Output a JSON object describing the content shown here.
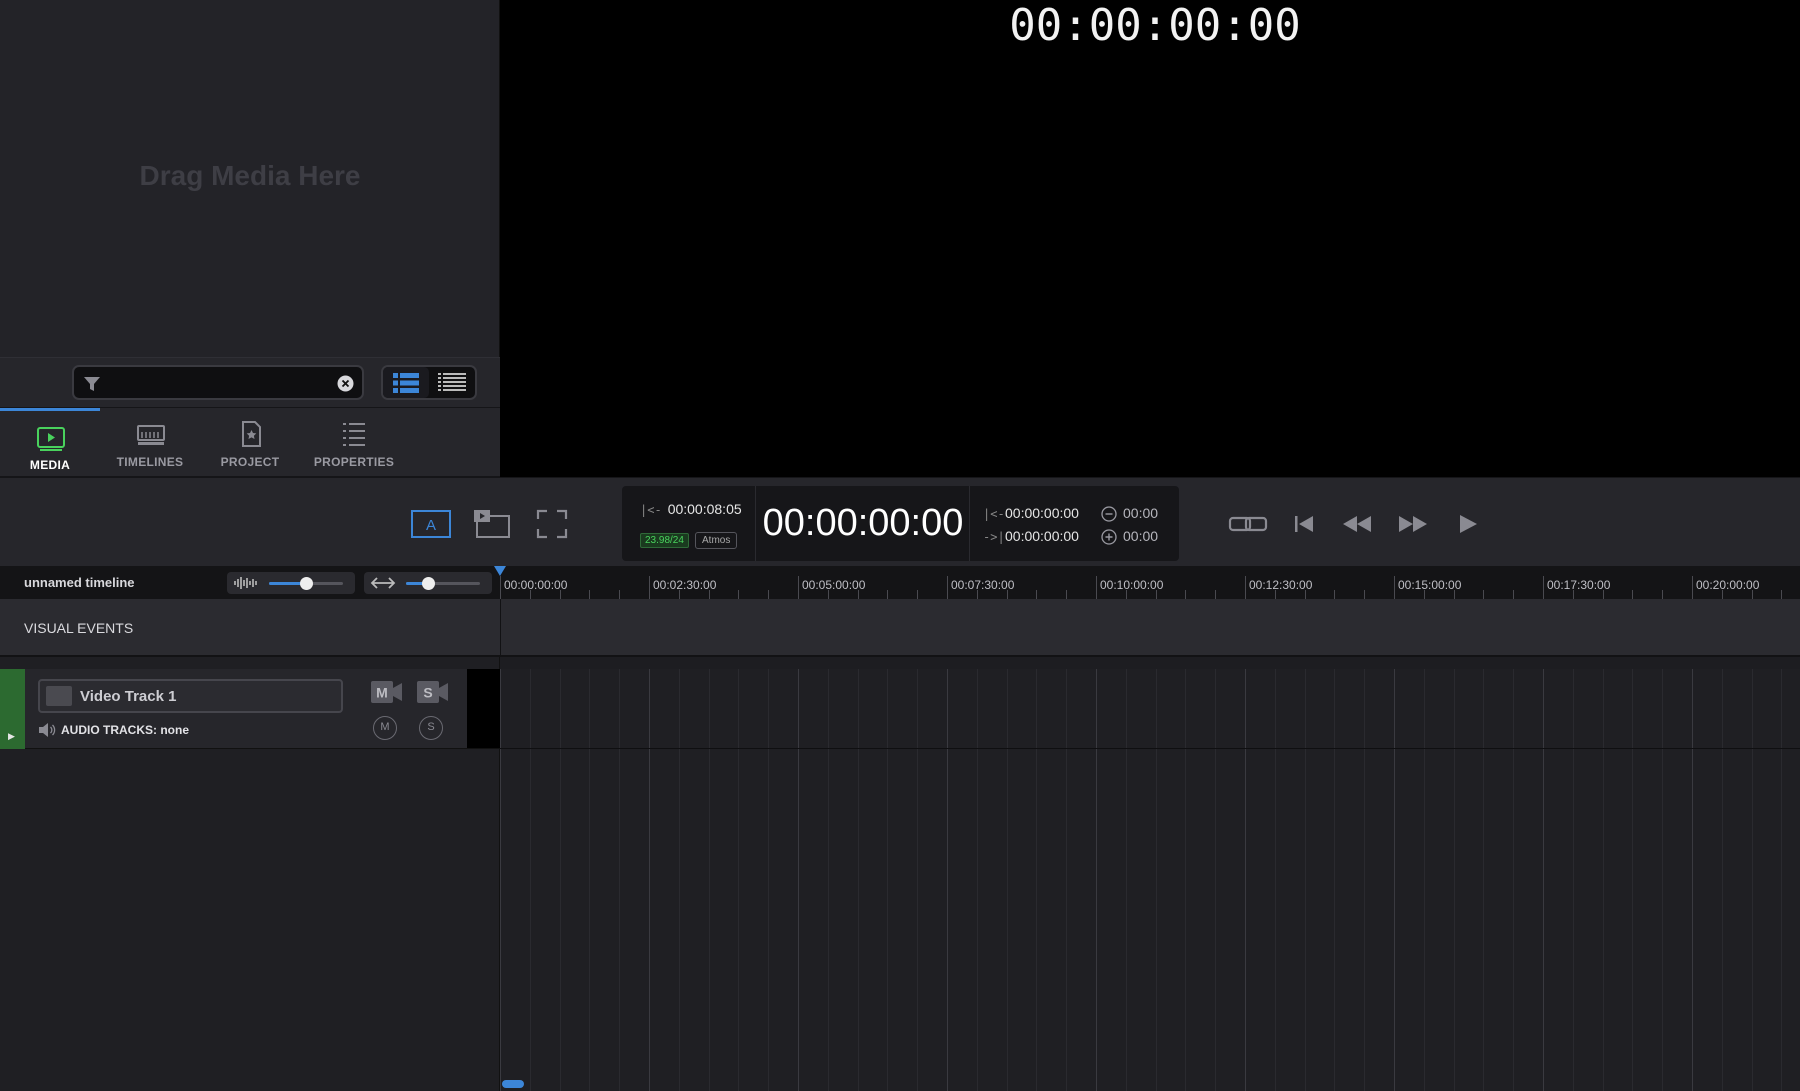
{
  "media_bin": {
    "drag_hint": "Drag Media Here",
    "search": {
      "value": "",
      "placeholder": ""
    },
    "view_modes": [
      "list-view",
      "compact-list-view"
    ],
    "tabs": [
      {
        "label": "MEDIA",
        "icon": "media-icon",
        "active": true
      },
      {
        "label": "TIMELINES",
        "icon": "timeline-icon",
        "active": false
      },
      {
        "label": "PROJECT",
        "icon": "project-icon",
        "active": false
      },
      {
        "label": "PROPERTIES",
        "icon": "properties-icon",
        "active": false
      }
    ]
  },
  "viewer": {
    "timecode": "00:00:00:00"
  },
  "transport": {
    "duration": "00:00:08:05",
    "fps": "23.98/24",
    "audio_format": "Atmos",
    "main_timecode": "00:00:00:00",
    "in_point": "00:00:00:00",
    "out_point": "00:00:00:00",
    "in_offset": "00:00",
    "out_offset": "00:00",
    "buttons": [
      "a-label-button",
      "picture-in-picture-button",
      "fullscreen-button",
      "link-button",
      "go-to-start-button",
      "rewind-button",
      "fast-forward-button",
      "play-button"
    ]
  },
  "timeline": {
    "name": "unnamed timeline",
    "audio_zoom": 0.5,
    "horizontal_zoom": 0.3,
    "ruler_labels": [
      "00:00:00:00",
      "00:02:30:00",
      "00:05:00:00",
      "00:07:30:00",
      "00:10:00:00",
      "00:12:30:00",
      "00:15:00:00",
      "00:17:30:00",
      "00:20:00:00"
    ],
    "visual_events_label": "VISUAL EVENTS",
    "tracks": [
      {
        "name": "Video Track 1",
        "audio_tracks": "AUDIO TRACKS: none",
        "mute": "M",
        "solo": "S"
      }
    ]
  },
  "colors": {
    "accent": "#3c86d8",
    "track": "#2c6a30",
    "fps_badge": "#49d25d"
  }
}
